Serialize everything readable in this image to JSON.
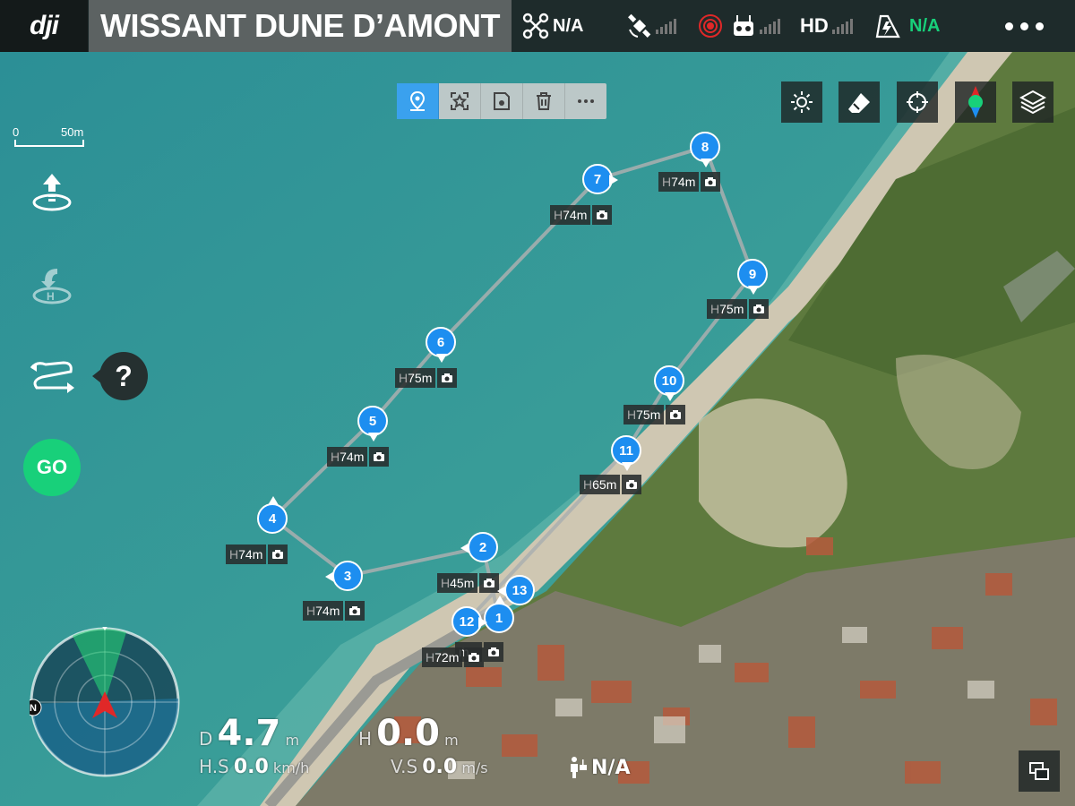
{
  "header": {
    "logo": "dji",
    "title": "WISSANT DUNE D’AMONT",
    "aircraft_status": "N/A",
    "video_label": "HD",
    "battery_status": "N/A",
    "icons": [
      "aircraft-icon",
      "gps-satellite-icon",
      "obstacle-sensor-icon",
      "remote-controller-icon",
      "hd-signal-icon",
      "battery-icon",
      "more-icon"
    ]
  },
  "waypoint_toolbar": {
    "icons": [
      "add-waypoint-icon",
      "poi-icon",
      "save-icon",
      "delete-icon",
      "more-icon"
    ],
    "active": "add-waypoint-icon"
  },
  "map_tools": {
    "icons": [
      "brightness-icon",
      "eraser-icon",
      "locate-icon",
      "compass-icon",
      "layers-icon"
    ]
  },
  "scale_bar": {
    "min_label": "0",
    "max_label": "50m"
  },
  "left_controls": {
    "icons": [
      "takeoff-icon",
      "return-home-icon",
      "waypoint-mission-icon"
    ],
    "help_label": "?",
    "go_label": "GO"
  },
  "colors": {
    "waypoint": "#1d8ef0",
    "go": "#18d07a",
    "toolbar_active": "#3aa1ee",
    "ok_status": "#18d07a"
  },
  "waypoints": [
    {
      "num": "1",
      "height": "",
      "visible_camera": true
    },
    {
      "num": "2",
      "height": "45m",
      "visible_camera": true
    },
    {
      "num": "3",
      "height": "74m",
      "visible_camera": true
    },
    {
      "num": "4",
      "height": "74m",
      "visible_camera": true
    },
    {
      "num": "5",
      "height": "74m",
      "visible_camera": true
    },
    {
      "num": "6",
      "height": "75m",
      "visible_camera": true
    },
    {
      "num": "7",
      "height": "74m",
      "visible_camera": true
    },
    {
      "num": "8",
      "height": "74m",
      "visible_camera": true
    },
    {
      "num": "9",
      "height": "75m",
      "visible_camera": true
    },
    {
      "num": "10",
      "height": "75m",
      "visible_camera": true
    },
    {
      "num": "11",
      "height": "65m",
      "visible_camera": true
    },
    {
      "num": "12",
      "height": "72m",
      "visible_camera": true
    },
    {
      "num": "13",
      "height": "",
      "visible_camera": false
    }
  ],
  "label_prefix": "H",
  "label_12_partial": "m",
  "radar": {
    "north_label": "N"
  },
  "telemetry": {
    "distance_label": "D",
    "distance_value": "4.7",
    "distance_unit": "m",
    "height_label": "H",
    "height_value": "0.0",
    "height_unit": "m",
    "hspeed_label": "H.S",
    "hspeed_value": "0.0",
    "hspeed_unit": "km/h",
    "vspeed_label": "V.S",
    "vspeed_value": "0.0",
    "vspeed_unit": "m/s",
    "rc_distance_value": "N/A"
  }
}
